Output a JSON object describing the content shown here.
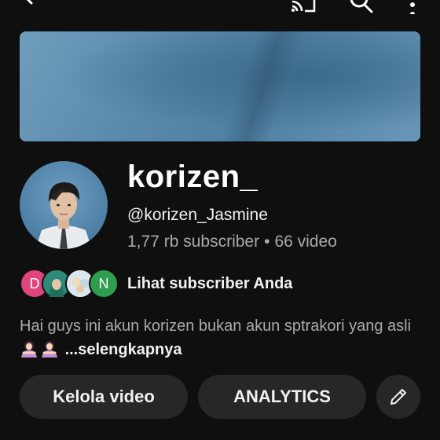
{
  "topbar": {
    "back_icon": "arrow-left-icon",
    "cast_icon": "cast-icon",
    "search_icon": "search-icon",
    "more_icon": "more-vertical-icon"
  },
  "channel": {
    "name": "korizen_",
    "handle": "@korizen_Jasmine",
    "subscribers": "1,77 rb subscriber",
    "separator": "•",
    "videos": "66 video"
  },
  "subscribers_preview": {
    "initials": [
      "D",
      "",
      "",
      "N"
    ],
    "colors": [
      "#e0457b",
      "#2b8a78",
      "#d9e7ef",
      "#2e9d4e"
    ],
    "label": "Lihat subscriber Anda"
  },
  "description": {
    "text": "Hai guys ini akun korizen bukan akun sptrakori yang asli",
    "more": "...selengkapnya"
  },
  "actions": {
    "manage_videos": "Kelola video",
    "analytics": "ANALYTICS",
    "edit_icon": "pencil-icon"
  },
  "colors": {
    "background": "#0f0f0f",
    "button": "#272727",
    "secondary_text": "#aaaaaa"
  }
}
